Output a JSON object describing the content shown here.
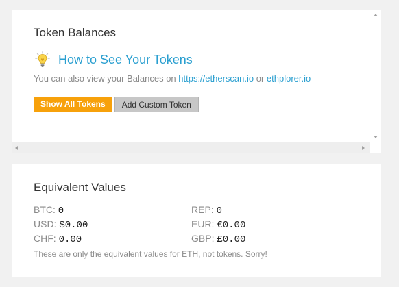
{
  "token_balances": {
    "title": "Token Balances",
    "howto_link": "How to See Your Tokens",
    "balances_prefix": "You can also view your Balances on ",
    "etherscan_link": "https://etherscan.io",
    "or_text": " or ",
    "ethplorer_link": "ethplorer.io",
    "show_all_button": "Show All Tokens",
    "add_custom_button": "Add Custom Token",
    "icons": {
      "howto": "lightbulb-icon",
      "scroll_up": "scroll-up-arrow-icon",
      "scroll_down": "scroll-down-arrow-icon",
      "scroll_left": "scroll-left-arrow-icon",
      "scroll_right": "scroll-right-arrow-icon"
    }
  },
  "equivalent_values": {
    "title": "Equivalent Values",
    "rows": [
      [
        {
          "label": "BTC: ",
          "value": "0"
        },
        {
          "label": "REP: ",
          "value": "0"
        }
      ],
      [
        {
          "label": "USD: ",
          "value": "$0.00"
        },
        {
          "label": "EUR: ",
          "value": "€0.00"
        }
      ],
      [
        {
          "label": "CHF: ",
          "value": "0.00"
        },
        {
          "label": "GBP: ",
          "value": "£0.00"
        }
      ]
    ],
    "note": "These are only the equivalent values for ETH, not tokens. Sorry!"
  },
  "colors": {
    "link": "#2a9fd0",
    "primary_button": "#f7a10b",
    "secondary_button": "#c7c7c7",
    "background": "#f1f1f1",
    "muted_text": "#8a8a8a"
  }
}
